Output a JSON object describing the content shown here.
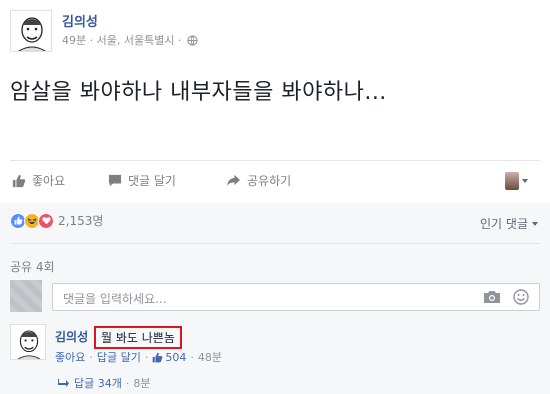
{
  "post": {
    "author": "김의성",
    "meta": "49분 · 서울, 서울특별시 ·",
    "text": "암살을 봐야하나 내부자들을 봐야하나..."
  },
  "actions": {
    "like": "좋아요",
    "comment": "댓글 달기",
    "share": "공유하기"
  },
  "reactions": {
    "icons": [
      "like-icon",
      "haha-icon",
      "love-icon"
    ],
    "count": "2,153명"
  },
  "sort_label": "인기 댓글",
  "shares": "공유 4회",
  "comment_input": {
    "placeholder": "댓글을 입력하세요..."
  },
  "comment": {
    "author": "김의성",
    "text": "뭘 봐도 나쁜놈",
    "like": "좋아요",
    "reply": "답글 달기",
    "likes": "504",
    "time": "48분",
    "replies": "답글 34개",
    "replies_time": "8분"
  },
  "colors": {
    "link": "#365899",
    "accent": "#4267b2",
    "highlight_box": "#e0141e",
    "gray_bg": "#f6f7f9"
  }
}
